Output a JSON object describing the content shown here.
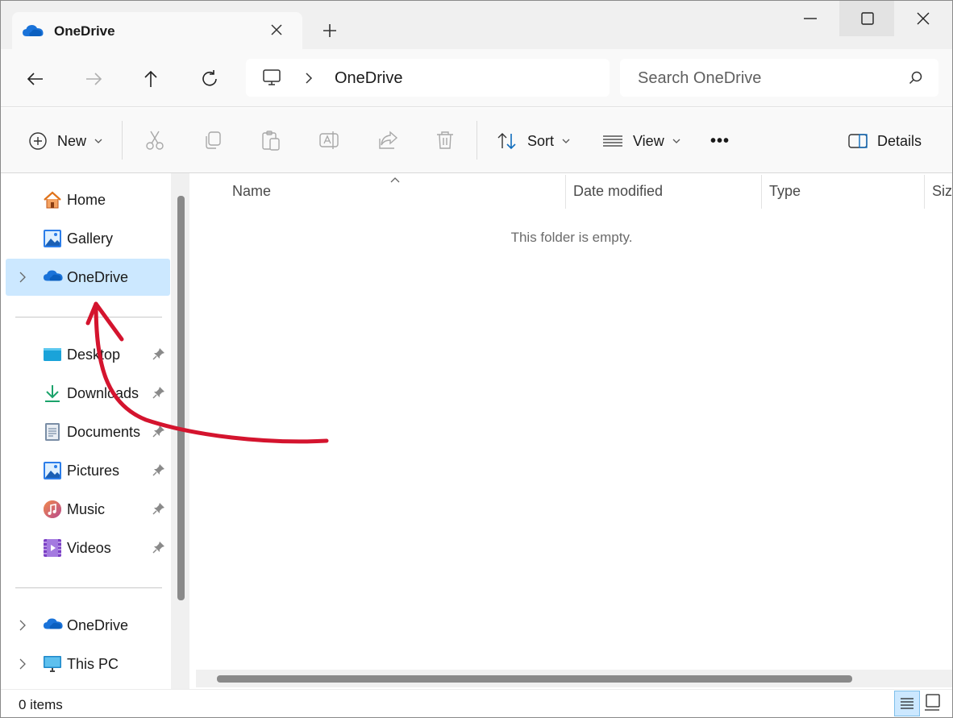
{
  "window": {
    "tab_title": "OneDrive",
    "tab_icon": "onedrive-cloud-icon",
    "controls": [
      "minimize-icon",
      "maximize-icon",
      "close-icon"
    ]
  },
  "toolbar": {
    "back_icon": "arrow-left-icon",
    "forward_icon": "arrow-right-icon",
    "up_icon": "arrow-up-icon",
    "refresh_icon": "refresh-icon",
    "breadcrumb": [
      "OneDrive"
    ],
    "search_placeholder": "Search OneDrive"
  },
  "commands": {
    "new_label": "New",
    "sort_label": "Sort",
    "view_label": "View",
    "more_label": "•••",
    "details_label": "Details",
    "disabled_icons": [
      "cut-icon",
      "copy-icon",
      "paste-icon",
      "rename-icon",
      "share-icon",
      "delete-icon"
    ]
  },
  "sidebar": {
    "top_items": [
      {
        "label": "Home",
        "icon": "home-icon"
      },
      {
        "label": "Gallery",
        "icon": "gallery-icon"
      },
      {
        "label": "OneDrive",
        "icon": "onedrive-cloud-icon",
        "selected": true
      }
    ],
    "pinned_items": [
      {
        "label": "Desktop",
        "icon": "desktop-folder-icon"
      },
      {
        "label": "Downloads",
        "icon": "download-icon"
      },
      {
        "label": "Documents",
        "icon": "documents-icon"
      },
      {
        "label": "Pictures",
        "icon": "pictures-icon"
      },
      {
        "label": "Music",
        "icon": "music-icon"
      },
      {
        "label": "Videos",
        "icon": "videos-icon"
      }
    ],
    "bottom_items": [
      {
        "label": "OneDrive",
        "icon": "onedrive-cloud-icon"
      },
      {
        "label": "This PC",
        "icon": "monitor-icon"
      }
    ]
  },
  "content": {
    "columns": [
      "Name",
      "Date modified",
      "Type",
      "Size"
    ],
    "empty_message": "This folder is empty."
  },
  "status": {
    "item_count": "0 items"
  },
  "colors": {
    "selection": "#cce8ff",
    "accent": "#0f6cbd",
    "annotation_arrow": "#d4142e"
  }
}
